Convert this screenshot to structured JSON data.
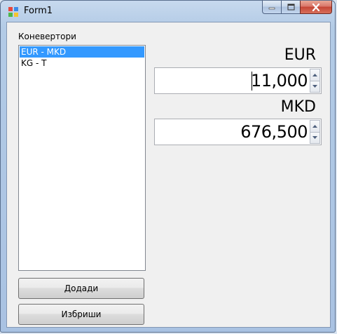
{
  "window": {
    "title": "Form1"
  },
  "converters": {
    "label": "Коневертори",
    "items": [
      {
        "label": "EUR - MKD",
        "selected": true
      },
      {
        "label": "KG - T",
        "selected": false
      }
    ]
  },
  "buttons": {
    "add_label": "Додади",
    "delete_label": "Избриши"
  },
  "from": {
    "unit": "EUR",
    "value": "11,000"
  },
  "to": {
    "unit": "MKD",
    "value": "676,500"
  },
  "colors": {
    "selection": "#3399ff",
    "close_button": "#c44535"
  }
}
